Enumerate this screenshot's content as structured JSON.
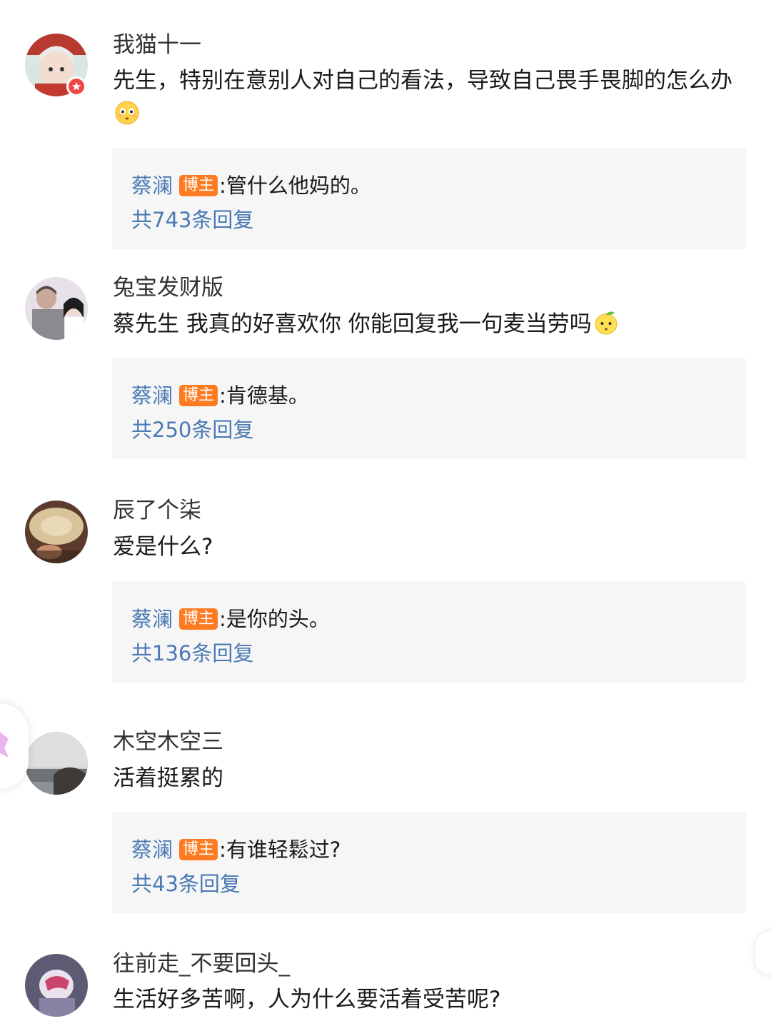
{
  "comments": [
    {
      "username": "我猫十一",
      "text": "先生，特别在意别人对自己的看法，导致自己畏手畏脚的怎么办",
      "emoji": "flushed-face-emoji",
      "verified": true,
      "reply": {
        "author": "蔡澜",
        "badge": "博主",
        "colon": ":",
        "text": "管什么他妈的。",
        "count": "共743条回复"
      }
    },
    {
      "username": "兔宝发财版",
      "text": "蔡先生 我真的好喜欢你 你能回复我一句麦当劳吗",
      "emoji": "lemon-face-emoji",
      "verified": false,
      "reply": {
        "author": "蔡澜",
        "badge": "博主",
        "colon": ":",
        "text": "肯德基。",
        "count": "共250条回复"
      }
    },
    {
      "username": "辰了个柒",
      "text": "爱是什么?",
      "verified": false,
      "reply": {
        "author": "蔡澜",
        "badge": "博主",
        "colon": ":",
        "text": "是你的头。",
        "count": "共136条回复"
      }
    },
    {
      "username": "木空木空三",
      "text": "活着挺累的",
      "verified": false,
      "reply": {
        "author": "蔡澜",
        "badge": "博主",
        "colon": ":",
        "text": "有谁轻鬆过?",
        "count": "共43条回复"
      }
    },
    {
      "username": "往前走_不要回头_",
      "text": "生活好多苦啊，人为什么要活着受苦呢?",
      "verified": false
    }
  ],
  "colors": {
    "link": "#4a79b4",
    "host_badge": "#ff7b21",
    "reply_bg": "#f6f6f6",
    "verified_badge": "#f04848"
  }
}
